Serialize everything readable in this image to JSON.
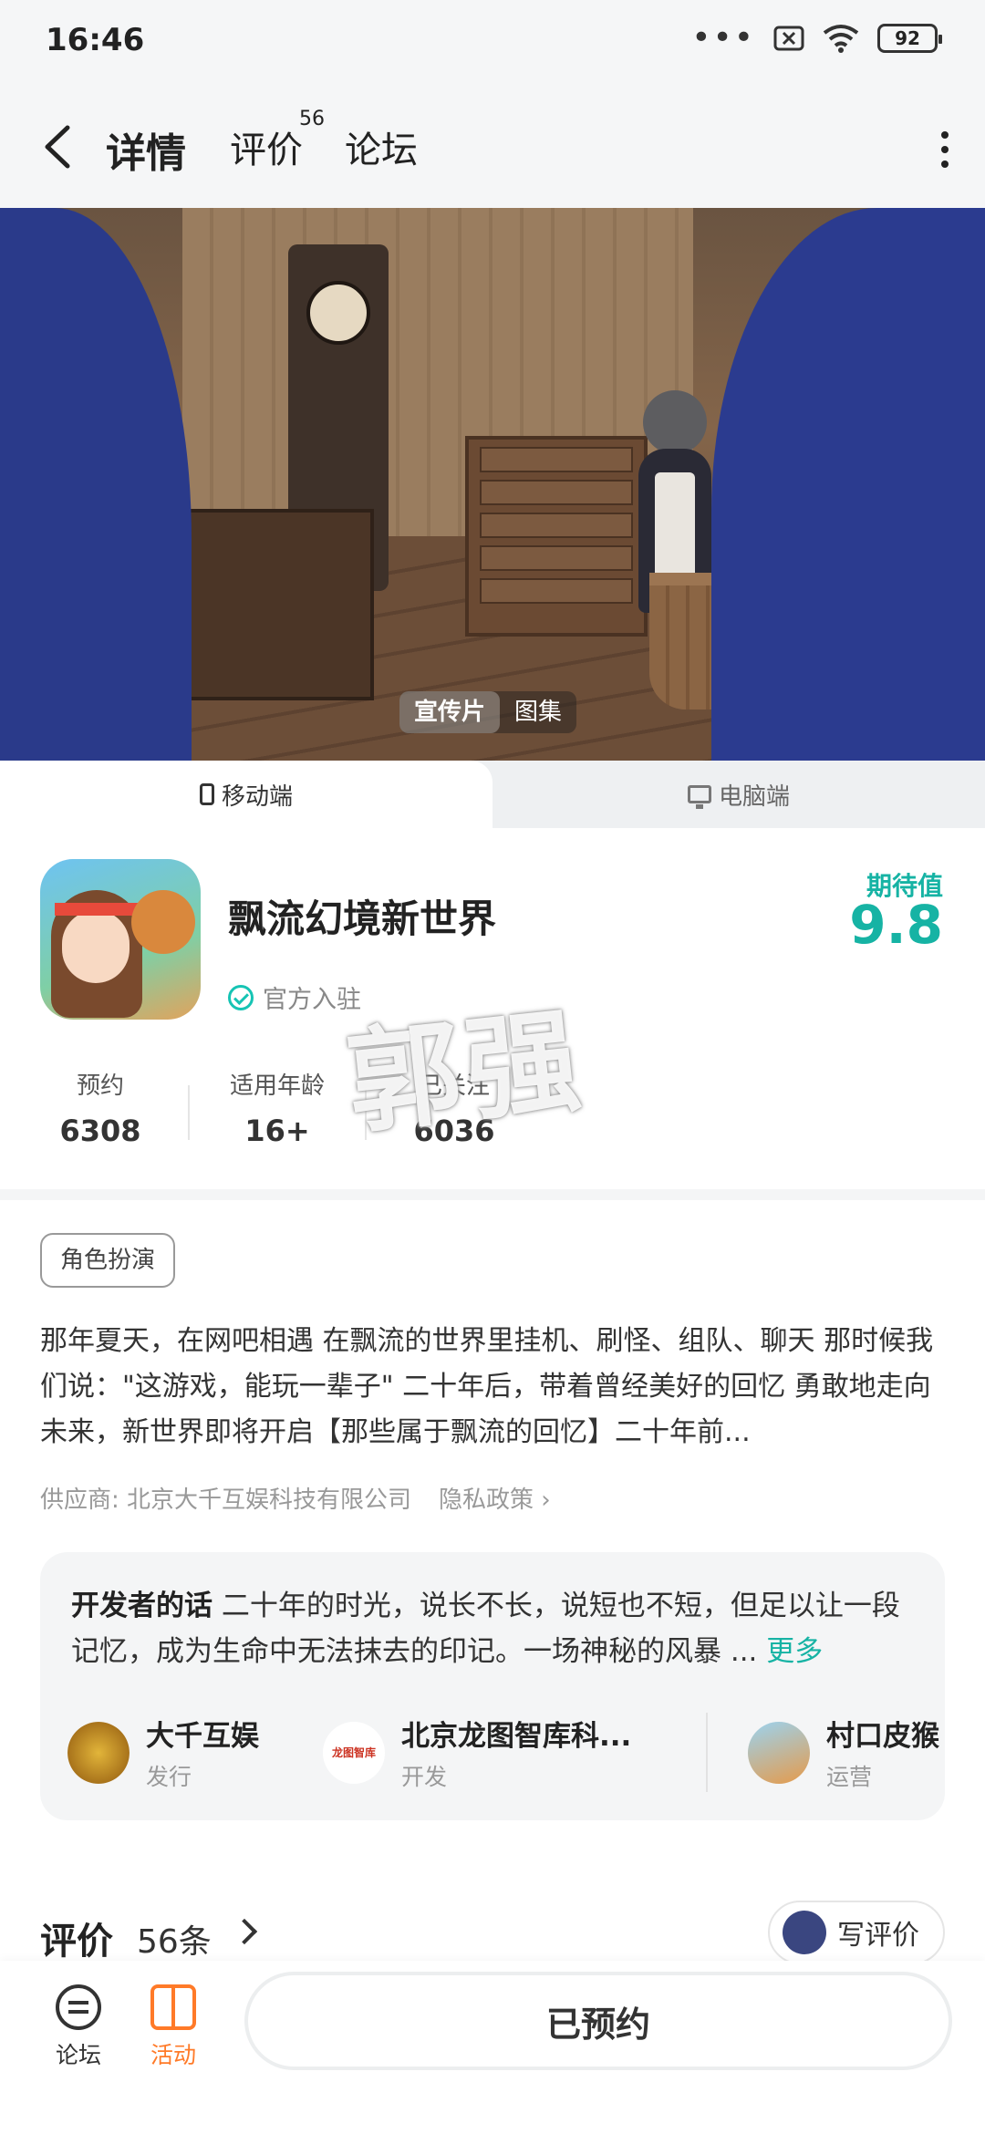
{
  "status_bar": {
    "time": "16:46",
    "battery": "92"
  },
  "nav": {
    "tabs": [
      {
        "label": "详情"
      },
      {
        "label": "评价",
        "badge": "56"
      },
      {
        "label": "论坛"
      }
    ]
  },
  "banner": {
    "pills": [
      "宣传片",
      "图集"
    ]
  },
  "platform_tabs": [
    "移动端",
    "电脑端"
  ],
  "game": {
    "title": "飘流幻境新世界",
    "official_label": "官方入驻",
    "expect_label": "期待值",
    "expect_value": "9.8",
    "stats": [
      {
        "label": "预约",
        "value": "6308"
      },
      {
        "label": "适用年龄",
        "value": "16+"
      },
      {
        "label": "已关注",
        "value": "6036"
      }
    ],
    "watermark": "郭强"
  },
  "tag": "角色扮演",
  "description": "那年夏天，在网吧相遇 在飘流的世界里挂机、刷怪、组队、聊天 那时候我们说：\"这游戏，能玩一辈子\" 二十年后，带着曾经美好的回忆 勇敢地走向未来，新世界即将开启【那些属于飘流的回忆】二十年前...",
  "supplier": "供应商: 北京大千互娱科技有限公司",
  "privacy": "隐私政策 ›",
  "developer_note": {
    "heading": "开发者的话",
    "text": "二十年的时光，说长不长，说短也不短，但足以让一段记忆，成为生命中无法抹去的印记。一场神秘的风暴 ...",
    "more": "更多"
  },
  "developers": [
    {
      "name": "大千互娱",
      "role": "发行"
    },
    {
      "name": "北京龙图智库科...",
      "role": "开发"
    },
    {
      "name": "村口皮猴",
      "role": "运营"
    }
  ],
  "reviews": {
    "title": "评价",
    "count": "56条",
    "write_label": "写评价"
  },
  "bottom_bar": {
    "forum": "论坛",
    "activity": "活动",
    "reserve_label": "已预约"
  }
}
